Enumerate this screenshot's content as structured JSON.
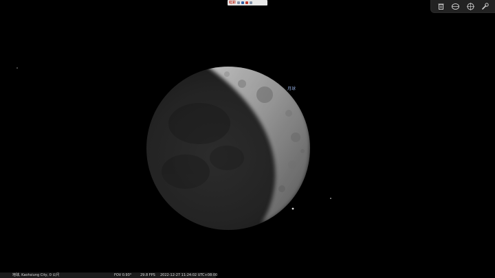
{
  "app": {
    "top_logo_text": "虹彩",
    "object_label": "月球"
  },
  "toolbar": {
    "buttons": [
      {
        "icon": "trash-icon"
      },
      {
        "icon": "eye-icon"
      },
      {
        "icon": "compass-icon"
      },
      {
        "icon": "wrench-icon"
      }
    ]
  },
  "status_bar": {
    "location": "地球, Kaohsiung City, 0 公尺",
    "fov": "FOV 0.93°",
    "fps": "29.8 FPS",
    "datetime": "2022-12-27 11:24:02 UTC+08:00"
  },
  "colors": {
    "background": "#000000",
    "label": "#8fa8d8",
    "status_text": "#dcdcdc"
  }
}
